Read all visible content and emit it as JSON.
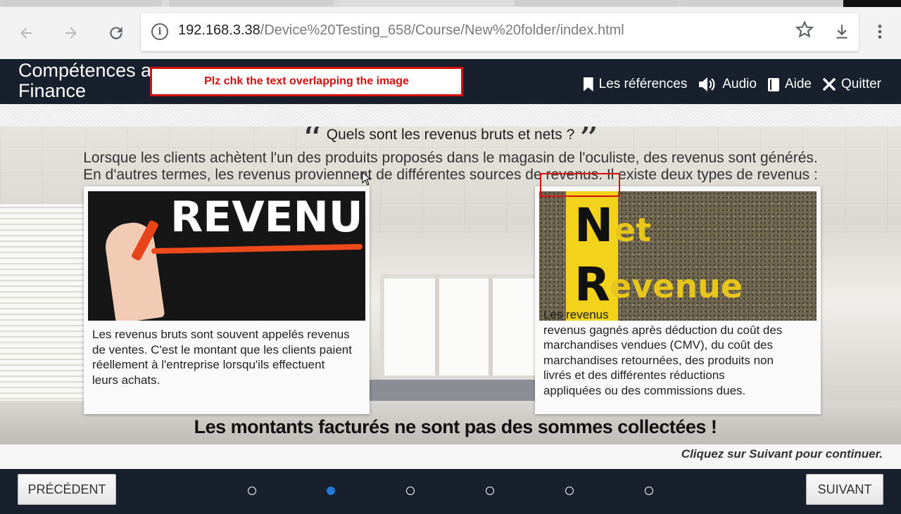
{
  "browser": {
    "url_host": "192.168.3.38",
    "url_path": "/Device%20Testing_658/Course/New%20folder/index.html",
    "icons": [
      "back-arrow-icon",
      "forward-arrow-icon",
      "reload-icon",
      "info-icon",
      "star-icon",
      "download-icon",
      "more-vert-icon"
    ]
  },
  "header": {
    "course_title_line1": "Compétences a",
    "course_title_line2": "Finance",
    "annotation": "Plz chk the text overlapping the image",
    "menu": [
      {
        "label": "Les références",
        "icon": "bookmark-icon"
      },
      {
        "label": "Audio",
        "icon": "speaker-icon"
      },
      {
        "label": "Aide",
        "icon": "book-icon"
      },
      {
        "label": "Quitter",
        "icon": "close-icon"
      }
    ]
  },
  "content": {
    "question": "Quels sont les revenus bruts et nets ?",
    "intro_line1": "Lorsque les clients achètent l'un des produits proposés dans le magasin de l'oculiste, des revenus sont générés.",
    "intro_line2": "En d'autres termes, les revenus proviennent de différentes sources de revenus. Il existe deux types de revenus :",
    "card_left": {
      "image_word": "REVENUE",
      "text": "Les revenus bruts sont souvent appelés revenus de ventes. C'est le montant que les clients paient réellement à l'entreprise lorsqu'ils effectuent leurs achats."
    },
    "card_right": {
      "image_letters": {
        "n": "N",
        "et": "et",
        "r": "R",
        "evenue": "evenue"
      },
      "overlap_text": "Les revenus",
      "text": "revenus gagnés après déduction du coût des marchandises vendues (CMV), du coût des marchandises retournées, des produits non livrés et des différentes réductions appliquées ou des commissions dues."
    },
    "warning": "Les montants facturés ne sont pas des sommes collectées !",
    "continue_hint": "Cliquez sur Suivant pour continuer."
  },
  "footer": {
    "prev_label": "PRÉCÉDENT",
    "next_label": "SUIVANT",
    "page_count": 6,
    "active_page": 2
  },
  "colors": {
    "header_bg": "#17202c",
    "annotation_red": "#d80f0f",
    "active_dot": "#1e78d6"
  }
}
